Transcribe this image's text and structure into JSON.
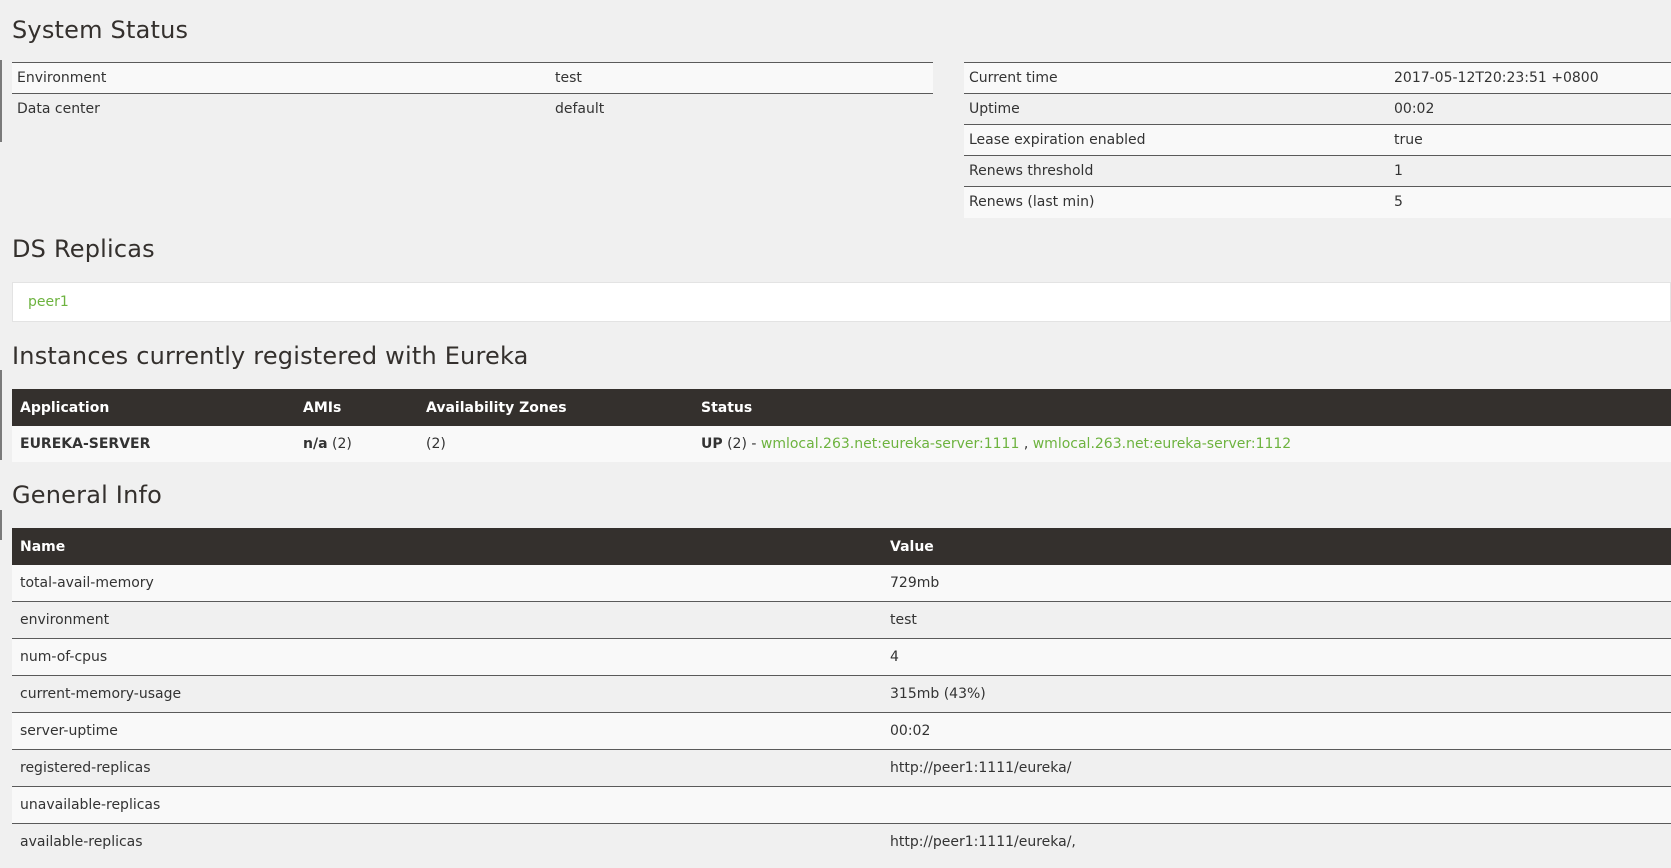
{
  "sections": {
    "system_status": "System Status",
    "ds_replicas": "DS Replicas",
    "instances": "Instances currently registered with Eureka",
    "general_info": "General Info"
  },
  "system_status_left": [
    {
      "label": "Environment",
      "value": "test"
    },
    {
      "label": "Data center",
      "value": "default"
    }
  ],
  "system_status_right": [
    {
      "label": "Current time",
      "value": "2017-05-12T20:23:51 +0800"
    },
    {
      "label": "Uptime",
      "value": "00:02"
    },
    {
      "label": "Lease expiration enabled",
      "value": "true"
    },
    {
      "label": "Renews threshold",
      "value": "1"
    },
    {
      "label": "Renews (last min)",
      "value": "5"
    }
  ],
  "replicas": [
    {
      "label": "peer1"
    }
  ],
  "instances_table": {
    "headers": [
      "Application",
      "AMIs",
      "Availability Zones",
      "Status"
    ],
    "rows": [
      {
        "application": "EUREKA-SERVER",
        "amis_label": "n/a",
        "amis_count": "(2)",
        "zones": "(2)",
        "status_label": "UP",
        "status_count": "(2) -",
        "links": [
          "wmlocal.263.net:eureka-server:1111",
          "wmlocal.263.net:eureka-server:1112"
        ],
        "link_separator": ","
      }
    ]
  },
  "general_table": {
    "headers": [
      "Name",
      "Value"
    ],
    "rows": [
      {
        "name": "total-avail-memory",
        "value": "729mb"
      },
      {
        "name": "environment",
        "value": "test"
      },
      {
        "name": "num-of-cpus",
        "value": "4"
      },
      {
        "name": "current-memory-usage",
        "value": "315mb (43%)"
      },
      {
        "name": "server-uptime",
        "value": "00:02"
      },
      {
        "name": "registered-replicas",
        "value": "http://peer1:1111/eureka/"
      },
      {
        "name": "unavailable-replicas",
        "value": ""
      },
      {
        "name": "available-replicas",
        "value": "http://peer1:1111/eureka/,"
      }
    ]
  },
  "colors": {
    "link_green": "#6db33f",
    "header_dark": "#34302d",
    "page_bg": "#f0f0f0"
  }
}
